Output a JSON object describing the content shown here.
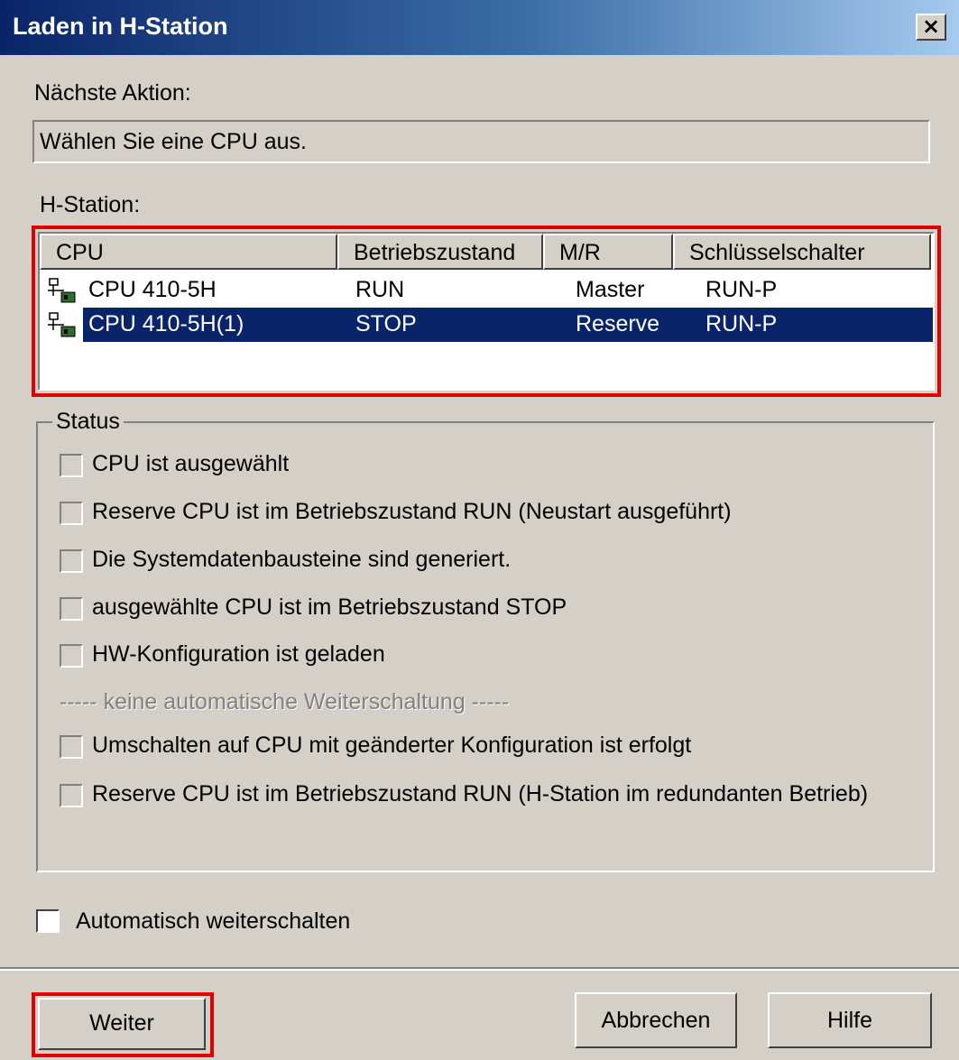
{
  "window": {
    "title": "Laden in H-Station",
    "close_glyph": "×"
  },
  "next_action": {
    "label": "Nächste Aktion:",
    "value": "Wählen Sie eine CPU aus."
  },
  "station": {
    "label": "H-Station:",
    "columns": [
      "CPU",
      "Betriebszustand",
      "M/R",
      "Schlüsselschalter"
    ],
    "rows": [
      {
        "cpu": "CPU 410-5H",
        "state": "RUN",
        "mr": "Master",
        "key": "RUN-P",
        "selected": false,
        "icon": "network-cpu-icon"
      },
      {
        "cpu": "CPU 410-5H(1)",
        "state": "STOP",
        "mr": "Reserve",
        "key": "RUN-P",
        "selected": true,
        "icon": "network-cpu-icon"
      }
    ]
  },
  "status": {
    "title": "Status",
    "items": [
      {
        "label": "CPU ist ausgewählt",
        "checked": false
      },
      {
        "label": "Reserve CPU ist im Betriebszustand RUN (Neustart ausgeführt)",
        "checked": false
      },
      {
        "label": "Die Systemdatenbausteine sind generiert.",
        "checked": false
      },
      {
        "label": "ausgewählte CPU ist im Betriebszustand STOP",
        "checked": false
      },
      {
        "label": "HW-Konfiguration ist geladen",
        "checked": false
      }
    ],
    "separator_text": "----- keine automatische Weiterschaltung -----",
    "manual_items": [
      {
        "label": "Umschalten auf CPU mit geänderter Konfiguration ist erfolgt",
        "checked": false
      },
      {
        "label": "Reserve CPU ist im Betriebszustand RUN (H-Station im redundanten Betrieb)",
        "checked": false
      }
    ]
  },
  "auto_advance": {
    "label": "Automatisch weiterschalten",
    "checked": false
  },
  "buttons": {
    "next": "Weiter",
    "cancel": "Abbrechen",
    "help": "Hilfe"
  },
  "colors": {
    "highlight": "#e00000",
    "selection": "#0a246a",
    "titlebar": "#0a246a"
  }
}
